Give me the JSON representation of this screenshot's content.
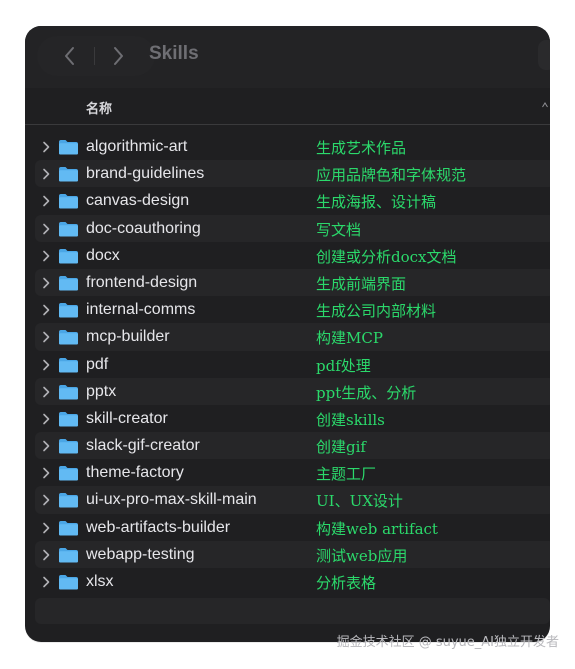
{
  "window": {
    "title": "Skills"
  },
  "header": {
    "column_name": "名称"
  },
  "icons": {
    "back": "chevron-left-icon",
    "forward": "chevron-right-icon",
    "row_expand": "chevron-right-icon",
    "folder": "folder-icon"
  },
  "colors": {
    "window_bg": "#1f1f21",
    "folder": "#57b5f2",
    "note_text": "#2bd96b",
    "name_text": "#e6e6ea"
  },
  "items": [
    {
      "name": "algorithmic-art",
      "note": "生成艺术作品"
    },
    {
      "name": "brand-guidelines",
      "note": "应用品牌色和字体规范"
    },
    {
      "name": "canvas-design",
      "note": "生成海报、设计稿"
    },
    {
      "name": "doc-coauthoring",
      "note": "写文档"
    },
    {
      "name": "docx",
      "note": "创建或分析docx文档"
    },
    {
      "name": "frontend-design",
      "note": "生成前端界面"
    },
    {
      "name": "internal-comms",
      "note": "生成公司内部材料"
    },
    {
      "name": "mcp-builder",
      "note": "构建MCP"
    },
    {
      "name": "pdf",
      "note": "pdf处理"
    },
    {
      "name": "pptx",
      "note": "ppt生成、分析"
    },
    {
      "name": "skill-creator",
      "note": "创建skills"
    },
    {
      "name": "slack-gif-creator",
      "note": "创建gif"
    },
    {
      "name": "theme-factory",
      "note": "主题工厂"
    },
    {
      "name": "ui-ux-pro-max-skill-main",
      "note": "UI、UX设计"
    },
    {
      "name": "web-artifacts-builder",
      "note": "构建web artifact"
    },
    {
      "name": "webapp-testing",
      "note": "测试web应用"
    },
    {
      "name": "xlsx",
      "note": "分析表格"
    }
  ],
  "watermark": "掘金技术社区 @ suyue_AI独立开发者"
}
